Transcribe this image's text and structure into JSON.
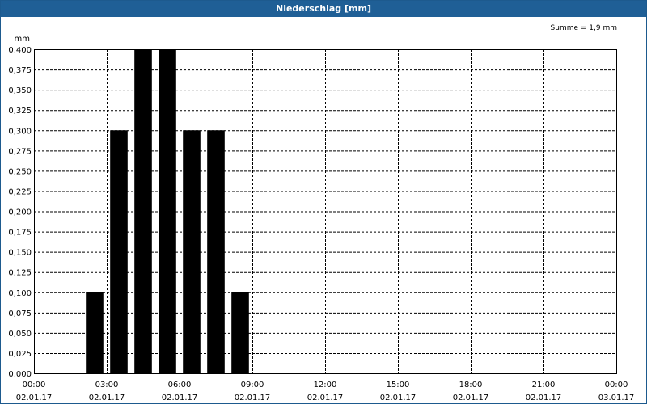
{
  "window": {
    "title": "Niederschlag [mm]"
  },
  "chart_data": {
    "type": "bar",
    "ylabel": "mm",
    "annotation": "Summe = 1,9 mm",
    "ylim": [
      0,
      0.4
    ],
    "y_tick_step": 0.025,
    "y_ticks": [
      "0,000",
      "0,025",
      "0,050",
      "0,075",
      "0,100",
      "0,125",
      "0,150",
      "0,175",
      "0,200",
      "0,225",
      "0,250",
      "0,275",
      "0,300",
      "0,325",
      "0,350",
      "0,375",
      "0,400"
    ],
    "x_ticks": [
      {
        "time": "00:00",
        "date": "02.01.17"
      },
      {
        "time": "03:00",
        "date": "02.01.17"
      },
      {
        "time": "06:00",
        "date": "02.01.17"
      },
      {
        "time": "09:00",
        "date": "02.01.17"
      },
      {
        "time": "12:00",
        "date": "02.01.17"
      },
      {
        "time": "15:00",
        "date": "02.01.17"
      },
      {
        "time": "18:00",
        "date": "02.01.17"
      },
      {
        "time": "21:00",
        "date": "02.01.17"
      },
      {
        "time": "00:00",
        "date": "03.01.17"
      }
    ],
    "x_range_hours": [
      0,
      24
    ],
    "bar_duration_hours": 1,
    "bars": [
      {
        "start_hour": 2,
        "value": 0.1
      },
      {
        "start_hour": 3,
        "value": 0.3
      },
      {
        "start_hour": 4,
        "value": 0.4
      },
      {
        "start_hour": 5,
        "value": 0.4
      },
      {
        "start_hour": 6,
        "value": 0.3
      },
      {
        "start_hour": 7,
        "value": 0.3
      },
      {
        "start_hour": 8,
        "value": 0.1
      }
    ],
    "grid": true,
    "bar_color": "#000000"
  }
}
